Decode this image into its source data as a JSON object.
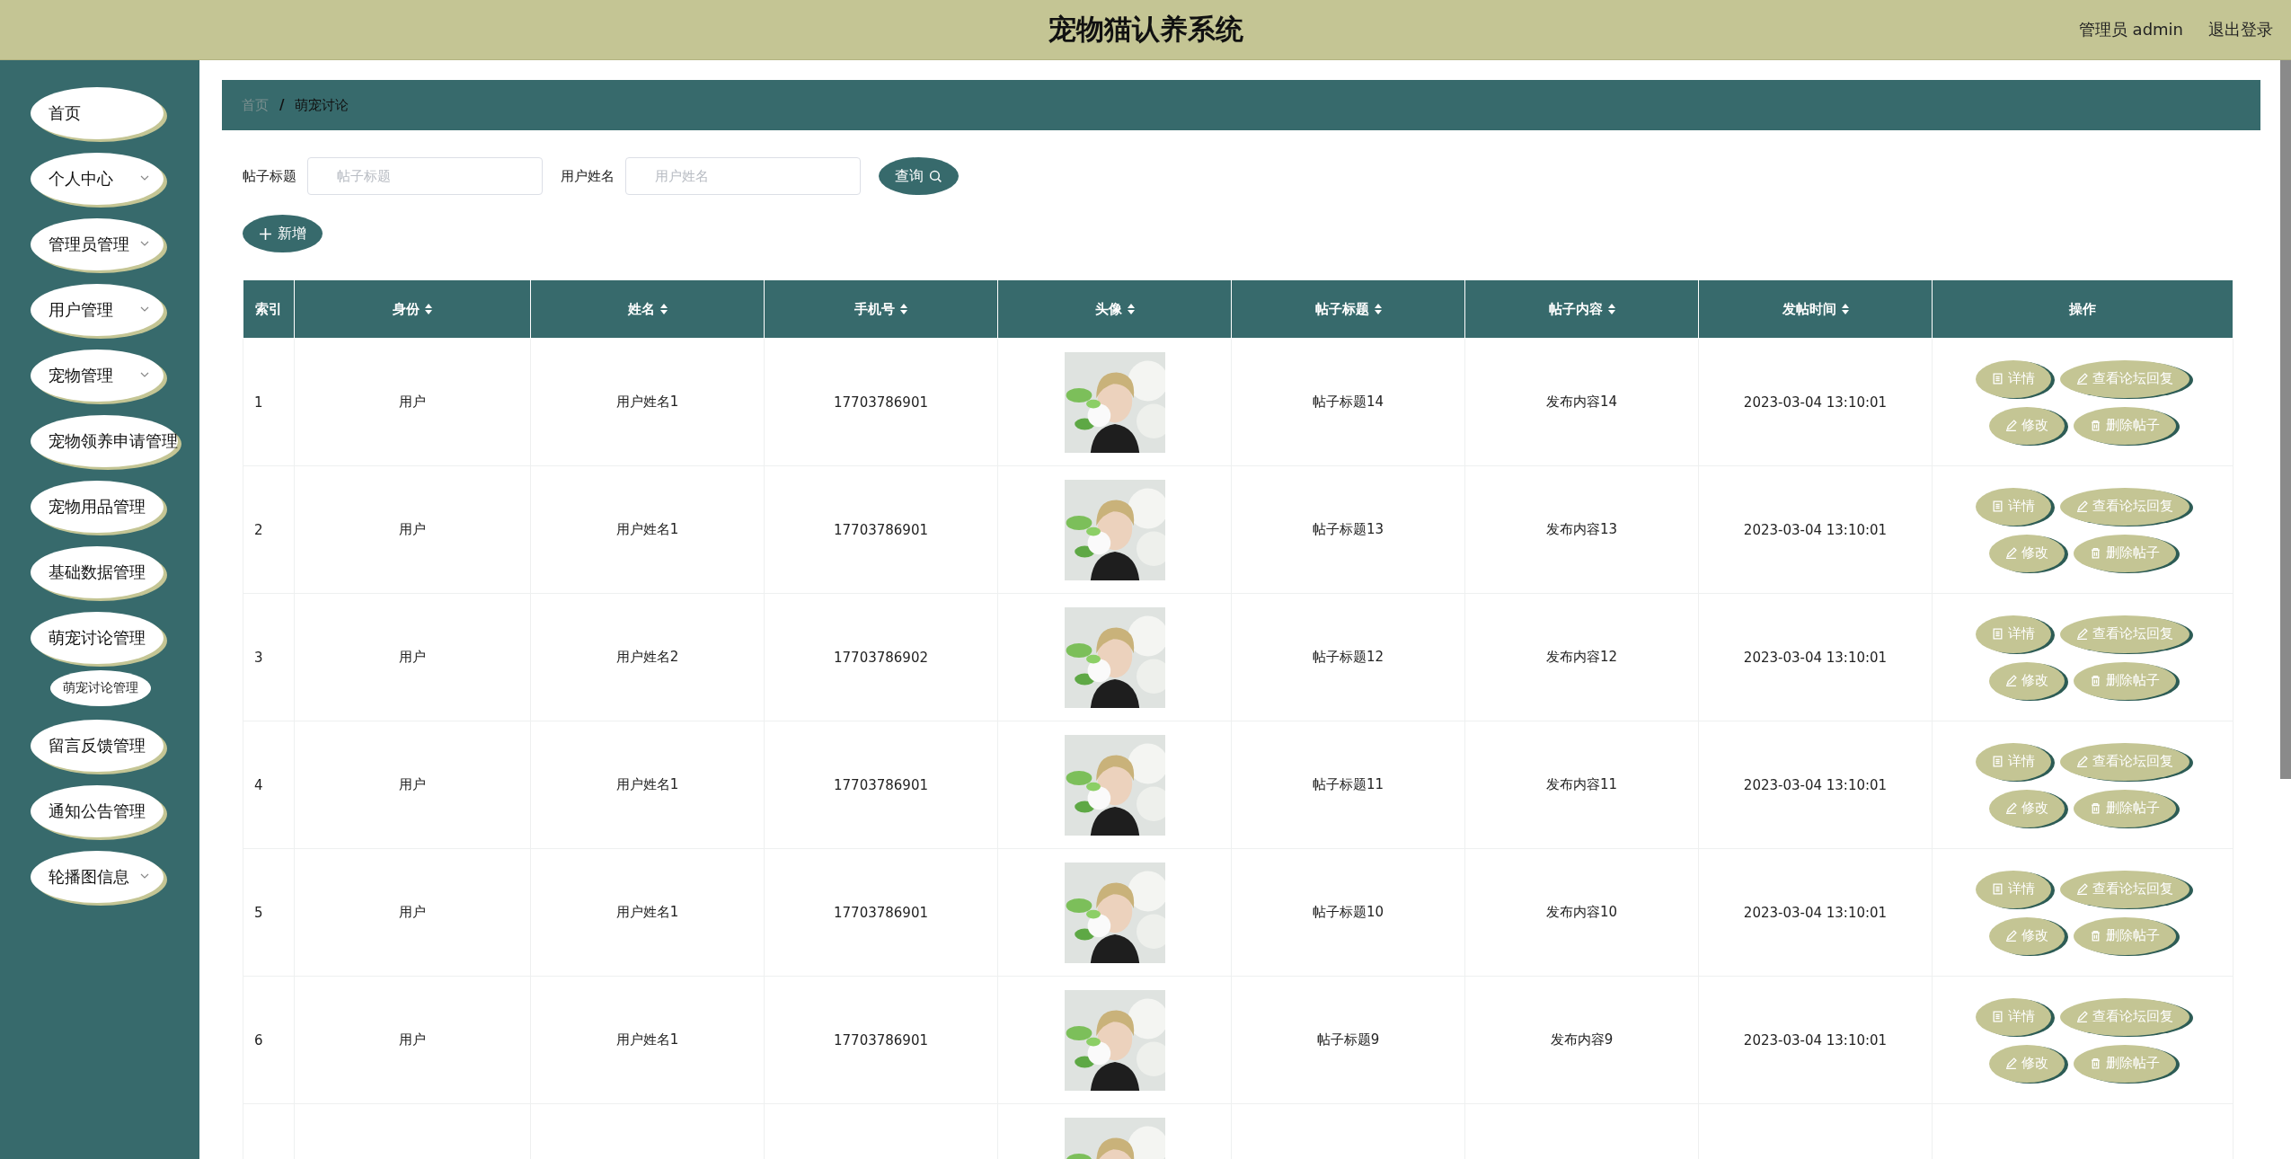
{
  "header": {
    "title": "宠物猫认养系统",
    "user": "管理员 admin",
    "logout": "退出登录"
  },
  "sidebar": {
    "items": [
      {
        "label": "首页",
        "dropdown": false
      },
      {
        "label": "个人中心",
        "dropdown": true
      },
      {
        "label": "管理员管理",
        "dropdown": true
      },
      {
        "label": "用户管理",
        "dropdown": true
      },
      {
        "label": "宠物管理",
        "dropdown": true
      },
      {
        "label": "宠物领养申请管理",
        "dropdown": false
      },
      {
        "label": "宠物用品管理",
        "dropdown": false
      },
      {
        "label": "基础数据管理",
        "dropdown": false
      },
      {
        "label": "萌宠讨论管理",
        "dropdown": false,
        "children": [
          {
            "label": "萌宠讨论管理"
          }
        ]
      },
      {
        "label": "留言反馈管理",
        "dropdown": false
      },
      {
        "label": "通知公告管理",
        "dropdown": false
      },
      {
        "label": "轮播图信息",
        "dropdown": true
      }
    ]
  },
  "breadcrumb": {
    "items": [
      {
        "label": "首页"
      },
      {
        "label": "萌宠讨论"
      }
    ],
    "separator": "/"
  },
  "search": {
    "fields": [
      {
        "label": "帖子标题",
        "placeholder": "帖子标题"
      },
      {
        "label": "用户姓名",
        "placeholder": "用户姓名"
      }
    ],
    "button": "查询",
    "add_button": "新增"
  },
  "table": {
    "columns": [
      {
        "label": "索引",
        "sortable": false
      },
      {
        "label": "身份",
        "sortable": true
      },
      {
        "label": "姓名",
        "sortable": true
      },
      {
        "label": "手机号",
        "sortable": true
      },
      {
        "label": "头像",
        "sortable": true
      },
      {
        "label": "帖子标题",
        "sortable": true
      },
      {
        "label": "帖子内容",
        "sortable": true
      },
      {
        "label": "发帖时间",
        "sortable": true
      },
      {
        "label": "操作",
        "sortable": false
      }
    ],
    "rows": [
      {
        "cells": [
          "1",
          "用户",
          "用户姓名1",
          "17703786901",
          "帖子标题14",
          "发布内容14",
          "2023-03-04 13:10:01"
        ],
        "avatar": {
          "kind": "picture"
        },
        "actions": [
          "详情",
          "查看论坛回复",
          "修改",
          "删除帖子"
        ]
      },
      {
        "cells": [
          "2",
          "用户",
          "用户姓名1",
          "17703786901",
          "帖子标题13",
          "发布内容13",
          "2023-03-04 13:10:01"
        ],
        "avatar": {
          "kind": "picture"
        },
        "actions": [
          "详情",
          "查看论坛回复",
          "修改",
          "删除帖子"
        ]
      },
      {
        "cells": [
          "3",
          "用户",
          "用户姓名2",
          "17703786902",
          "帖子标题12",
          "发布内容12",
          "2023-03-04 13:10:01"
        ],
        "avatar": {
          "kind": "picture"
        },
        "actions": [
          "详情",
          "查看论坛回复",
          "修改",
          "删除帖子"
        ]
      },
      {
        "cells": [
          "4",
          "用户",
          "用户姓名1",
          "17703786901",
          "帖子标题11",
          "发布内容11",
          "2023-03-04 13:10:01"
        ],
        "avatar": {
          "kind": "picture"
        },
        "actions": [
          "详情",
          "查看论坛回复",
          "修改",
          "删除帖子"
        ]
      },
      {
        "cells": [
          "5",
          "用户",
          "用户姓名1",
          "17703786901",
          "帖子标题10",
          "发布内容10",
          "2023-03-04 13:10:01"
        ],
        "avatar": {
          "kind": "picture"
        },
        "actions": [
          "详情",
          "查看论坛回复",
          "修改",
          "删除帖子"
        ]
      },
      {
        "cells": [
          "6",
          "用户",
          "用户姓名1",
          "17703786901",
          "帖子标题9",
          "发布内容9",
          "2023-03-04 13:10:01"
        ],
        "avatar": {
          "kind": "picture"
        },
        "actions": [
          "详情",
          "查看论坛回复",
          "修改",
          "删除帖子"
        ]
      },
      {
        "avatar": {
          "kind": "picture"
        }
      }
    ]
  }
}
